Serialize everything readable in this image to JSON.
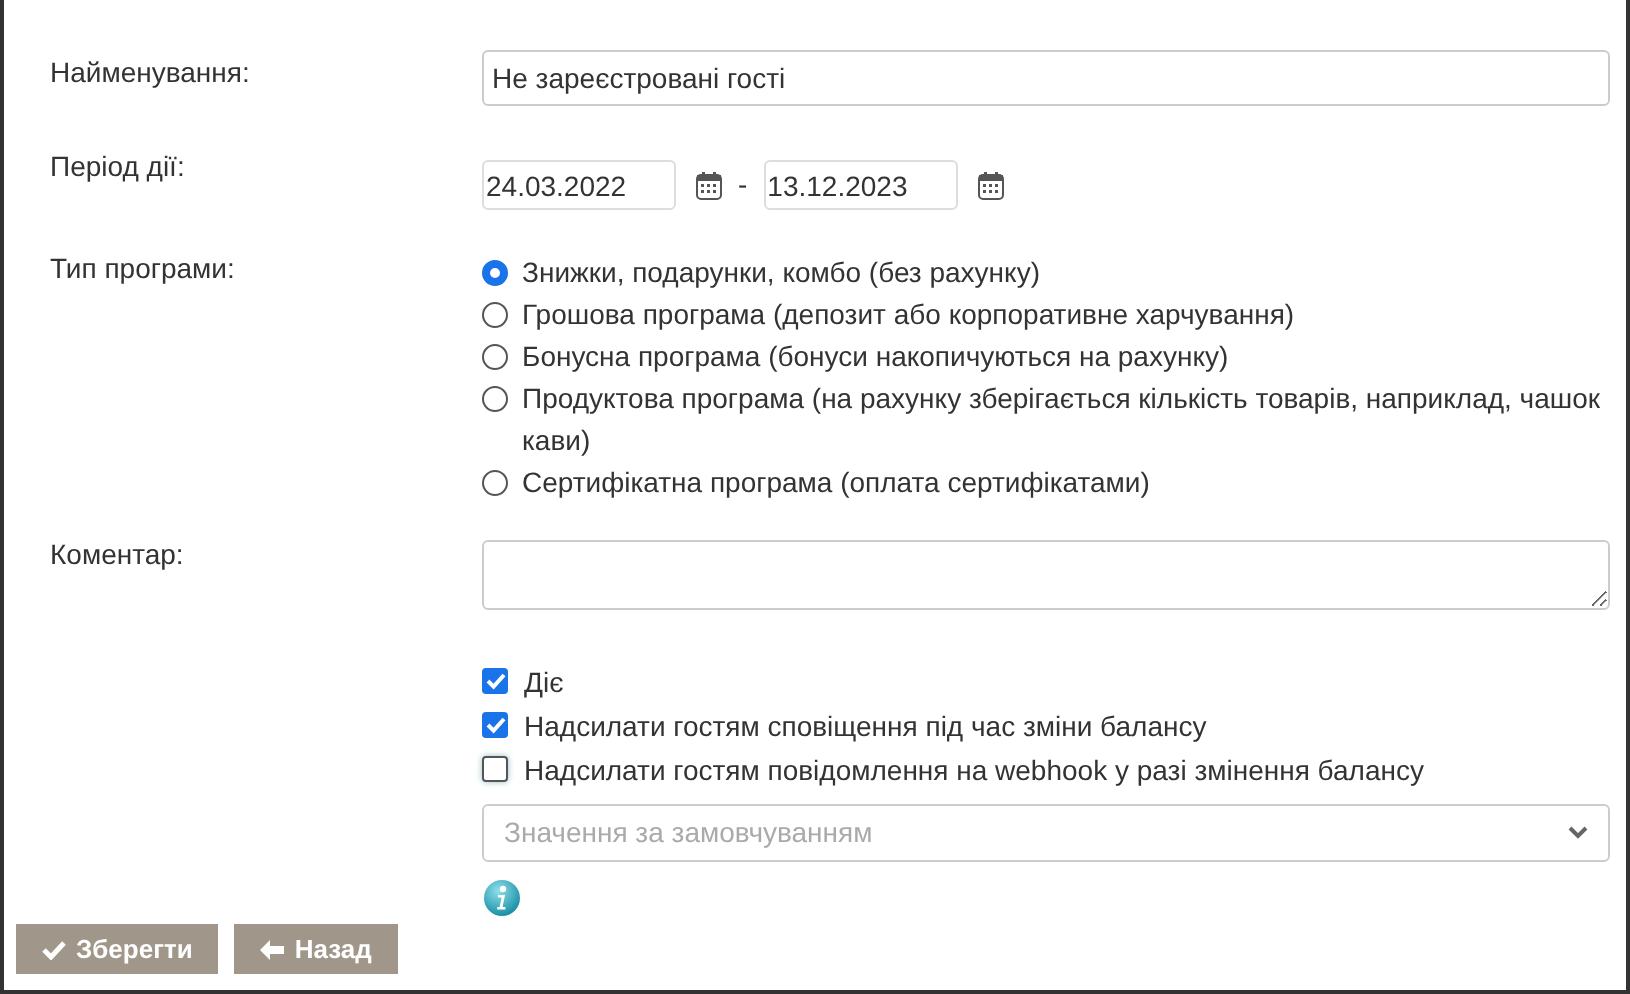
{
  "fields": {
    "name_label": "Найменування:",
    "name_value": "Не зареєстровані гості",
    "period_label": "Період дії:",
    "date_from": "24.03.2022",
    "date_separator": "-",
    "date_to": "13.12.2023",
    "type_label": "Тип програми:",
    "comment_label": "Коментар:"
  },
  "program_types": [
    {
      "label": "Знижки, подарунки, комбо (без рахунку)",
      "selected": true
    },
    {
      "label": "Грошова програма (депозит або корпоративне харчування)",
      "selected": false
    },
    {
      "label": "Бонусна програма (бонуси накопичуються на рахунку)",
      "selected": false
    },
    {
      "label": "Продуктова програма (на рахунку зберігається кількість товарів, наприклад, чашок кави)",
      "selected": false
    },
    {
      "label": "Сертифікатна програма (оплата сертифікатами)",
      "selected": false
    }
  ],
  "options": [
    {
      "label": "Діє",
      "checked": true
    },
    {
      "label": "Надсилати гостям сповіщення під час зміни балансу",
      "checked": true
    },
    {
      "label": "Надсилати гостям повідомлення на webhook у разі змінення балансу",
      "checked": false
    }
  ],
  "webhook_select": {
    "placeholder": "Значення за замовчуванням"
  },
  "buttons": [
    {
      "kind": "save",
      "label": "Зберегти"
    },
    {
      "kind": "back",
      "label": "Назад"
    }
  ]
}
